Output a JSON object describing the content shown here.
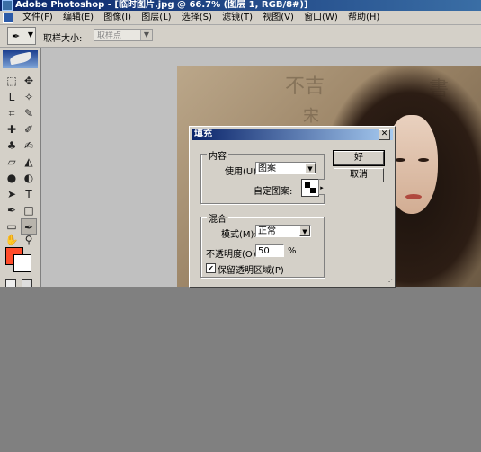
{
  "window": {
    "title": "Adobe Photoshop - [临时图片.jpg @ 66.7% (图层 1, RGB/8#)]"
  },
  "menu": [
    "文件(F)",
    "编辑(E)",
    "图像(I)",
    "图层(L)",
    "选择(S)",
    "滤镜(T)",
    "视图(V)",
    "窗口(W)",
    "帮助(H)"
  ],
  "options_bar": {
    "sample_size_label": "取样大小:",
    "sample_size_value": "取样点"
  },
  "toolbox": {
    "foreground_color": "#ff4c2a",
    "background_color": "#ffffff"
  },
  "dialog": {
    "title": "填充",
    "close_glyph": "✕",
    "content_group": {
      "label": "内容",
      "use_label": "使用(U):",
      "use_value": "图案",
      "custom_pattern_label": "自定图案:"
    },
    "blend_group": {
      "label": "混合",
      "mode_label": "模式(M):",
      "mode_value": "正常",
      "opacity_label": "不透明度(O):",
      "opacity_value": "50",
      "opacity_unit": "%",
      "preserve_transparency_label": "保留透明区域(P)",
      "preserve_transparency_checked": true
    },
    "ok_button": "好",
    "cancel_button": "取消"
  }
}
